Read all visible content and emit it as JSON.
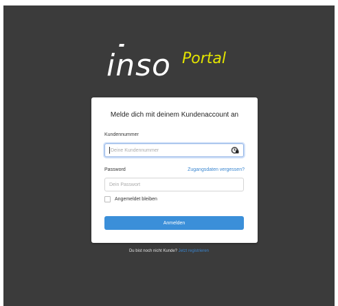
{
  "brand": {
    "logo_main": "inso",
    "logo_sub": "Portal",
    "accent_color": "#e3e400"
  },
  "login": {
    "title": "Melde dich mit deinem Kundenaccount an",
    "customer_number_label": "Kundennummer",
    "customer_number_placeholder": "Deine Kundennummer",
    "customer_number_value": "",
    "password_label": "Password",
    "password_placeholder": "Dein Passwort",
    "password_value": "",
    "forgot_link": "Zugangsdaten vergessen?",
    "remember_label": "Angemeldet bleiben",
    "remember_checked": false,
    "submit_label": "Anmelden",
    "button_color": "#3b8fd9"
  },
  "footer": {
    "text": "Du bist noch nicht Kunde?",
    "link": "Jetzt registrieren"
  }
}
